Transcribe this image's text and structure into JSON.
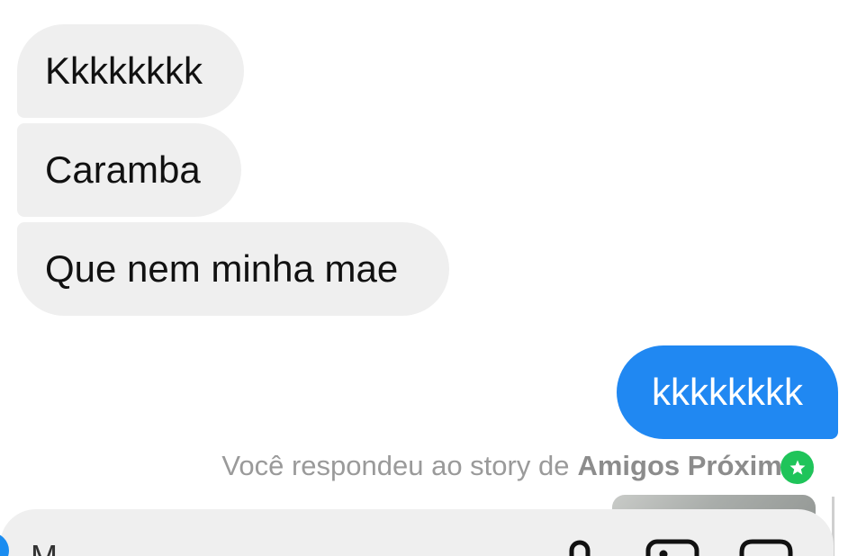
{
  "conversation": {
    "incoming": [
      {
        "text": "Kkkkkkkk"
      },
      {
        "text": "Caramba"
      },
      {
        "text": "Que nem minha mae"
      }
    ],
    "outgoing": [
      {
        "text": "kkkkkkkk"
      }
    ],
    "story_reply": {
      "prefix": "Você respondeu ao story de",
      "audience": "Amigos Próximos",
      "badge_icon": "star-icon",
      "badge_color": "#1fc45a"
    }
  },
  "composer": {
    "placeholder_visible_fragment": "M",
    "icons": [
      "microphone-icon",
      "gallery-icon",
      "sticker-icon"
    ]
  },
  "colors": {
    "incoming_bubble": "#efefef",
    "outgoing_bubble": "#2088f2"
  }
}
